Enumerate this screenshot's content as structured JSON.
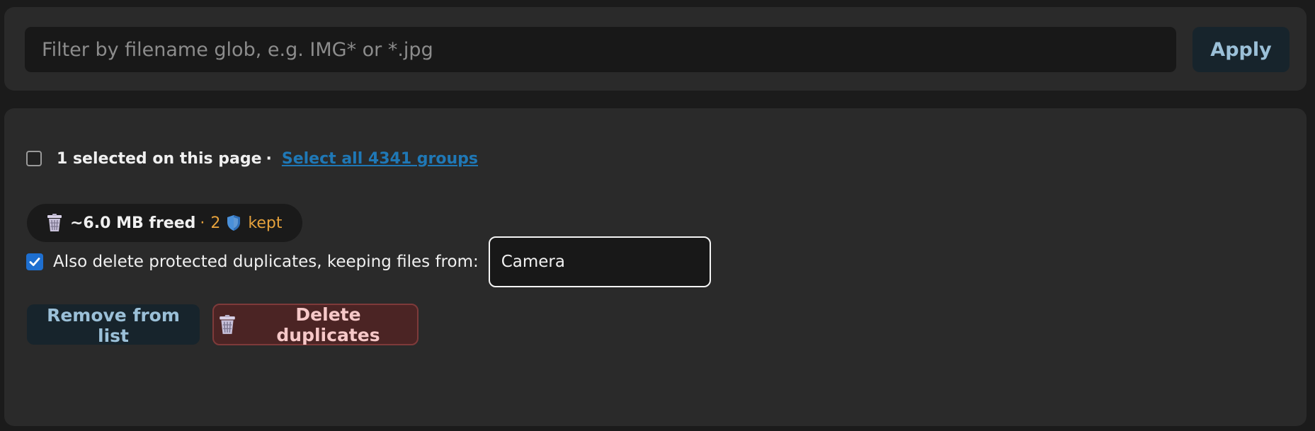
{
  "filter": {
    "placeholder": "Filter by filename glob, e.g. IMG* or *.jpg",
    "value": "",
    "apply_label": "Apply"
  },
  "selection": {
    "checked": false,
    "label": "1 selected on this page",
    "separator": "·",
    "select_all_link": "Select all 4341 groups"
  },
  "summary": {
    "trash_icon": "trash-icon",
    "freed": "~6.0 MB freed",
    "separator": "·",
    "kept_count": "2",
    "shield_icon": "shield-icon",
    "kept_label": "kept"
  },
  "protected": {
    "checked": true,
    "label": "Also delete protected duplicates, keeping files from:",
    "folder_value": "Camera"
  },
  "actions": {
    "remove_label": "Remove from list",
    "delete_icon": "trash-icon",
    "delete_label": "Delete duplicates"
  },
  "colors": {
    "accent_link": "#1f78b6",
    "kept": "#e6a23c",
    "checkbox": "#1e6fd0",
    "danger_bg": "#4b2424",
    "danger_text": "#f6c8c8",
    "secondary_btn_text": "#9bc0d8"
  }
}
